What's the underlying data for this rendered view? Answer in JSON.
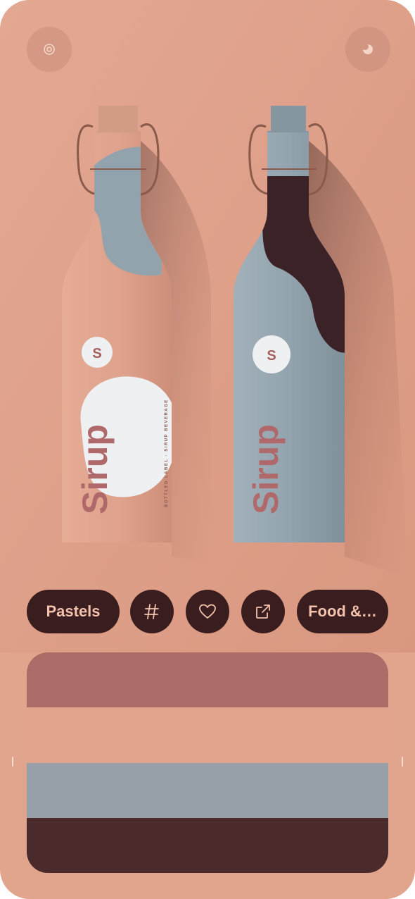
{
  "colors": {
    "background": "#e1a48d",
    "chip_bg": "#3a1d1f",
    "chip_text": "#f2c2ac",
    "bottle_pink": "#d9a08c",
    "bottle_blue": "#93a3ad",
    "bottle_dark": "#3b2226"
  },
  "header": {
    "left_icon": "circle-target-icon",
    "right_icon": "half-moon-icon"
  },
  "hero": {
    "bottle_left": {
      "brand": "Sirup",
      "badge": "S",
      "side_text": "BOTTLED LABEL · SIRUP BEVERAGE"
    },
    "bottle_right": {
      "brand": "Sirup",
      "badge": "S"
    }
  },
  "chips": {
    "style_label": "Pastels",
    "hashtag_icon": "hashtag-icon",
    "like_icon": "heart-icon",
    "share_icon": "share-out-icon",
    "category_label": "Food &…"
  },
  "palette": {
    "swatches": [
      {
        "name": "rose",
        "hex": "#ab6b67"
      },
      {
        "name": "peach",
        "hex": "#e2a48d"
      },
      {
        "name": "slate",
        "hex": "#97a0a8"
      },
      {
        "name": "maroon",
        "hex": "#4b2a2c"
      }
    ]
  }
}
